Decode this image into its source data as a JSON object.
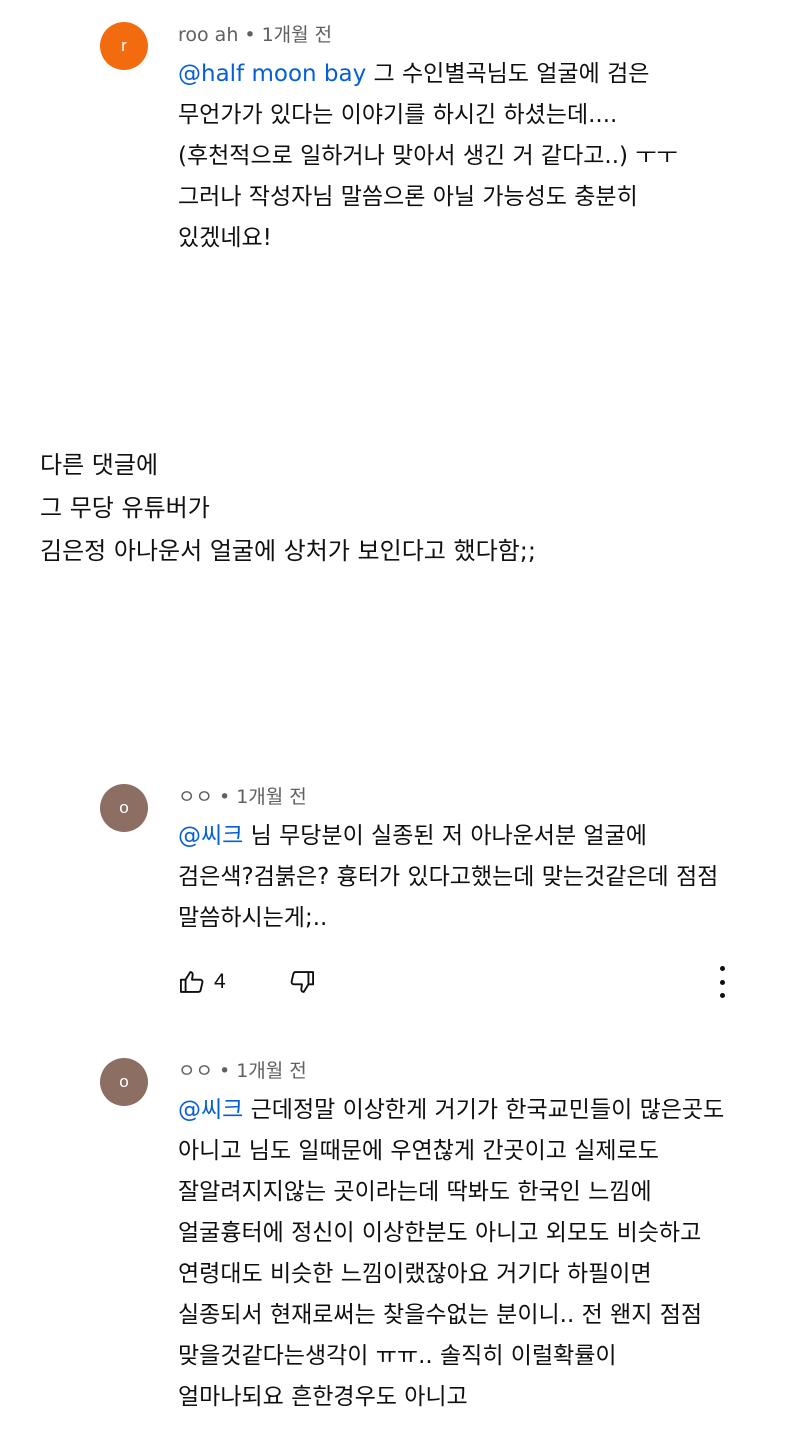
{
  "colors": {
    "mention": "#065fd4",
    "meta": "#606060",
    "text": "#0f0f0f"
  },
  "comment1": {
    "avatar_letter": "r",
    "avatar_color": "#f26b0f",
    "author": "roo ah",
    "separator": "•",
    "time": "1개월 전",
    "mention": "@half moon bay",
    "text": " 그  수인별곡님도 얼굴에 검은 무언가가 있다는 이야기를 하시긴 하셨는데....(후천적으로 일하거나 맞아서 생긴 거 같다고..) ㅜㅜ 그러나 작성자님 말씀으론 아닐 가능성도 충분히 있겠네요!"
  },
  "article": {
    "lines": [
      "다른 댓글에",
      "그 무당 유튜버가",
      "김은정 아나운서 얼굴에 상처가 보인다고 했다함;;"
    ]
  },
  "comment2": {
    "avatar_letter": "o",
    "avatar_color": "#8d6e63",
    "author": "ㅇㅇ",
    "separator": "•",
    "time": "1개월 전",
    "mention": "@씨크",
    "text": " 님 무당분이 실종된 저 아나운서분 얼굴에 검은색?검붉은? 흉터가 있다고했는데 맞는것같은데 점점 말씀하시는게;..",
    "like_count": "4",
    "icons": [
      "thumbs-up-icon",
      "thumbs-down-icon",
      "more-vert-icon"
    ]
  },
  "comment3": {
    "avatar_letter": "o",
    "avatar_color": "#8d6e63",
    "author": "ㅇㅇ",
    "separator": "•",
    "time": "1개월 전",
    "mention": "@씨크",
    "text": " 근데정말 이상한게 거기가 한국교민들이 많은곳도 아니고 님도 일때문에 우연찮게 간곳이고 실제로도 잘알려지지않는 곳이라는데 딱봐도 한국인 느낌에 얼굴흉터에 정신이 이상한분도 아니고 외모도 비슷하고 연령대도 비슷한 느낌이랬잖아요 거기다 하필이면 실종되서 현재로써는 찾을수없는 분이니.. 전 왠지 점점 맞을것같다는생각이 ㅠㅠ.. 솔직히 이럴확률이 얼마나되요 흔한경우도 아니고"
  }
}
